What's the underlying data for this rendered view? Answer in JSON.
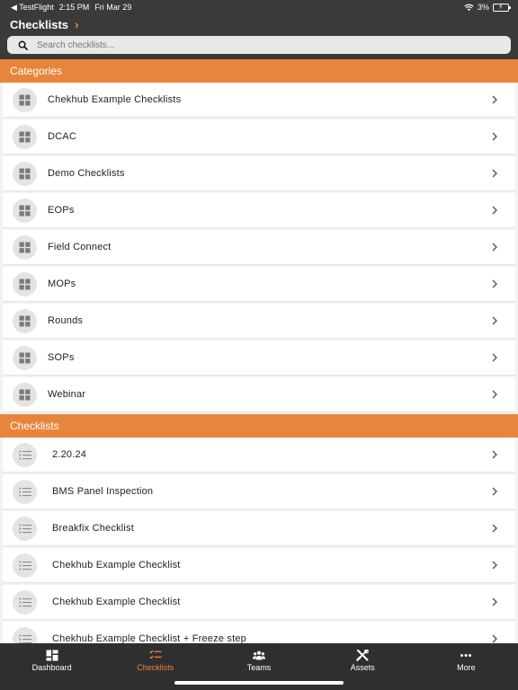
{
  "status": {
    "back_app": "◀ TestFlight",
    "time": "2:15 PM",
    "date": "Fri Mar 29",
    "battery": "3%"
  },
  "nav": {
    "title": "Checklists",
    "chevron": "›"
  },
  "search": {
    "placeholder": "Search checklists..."
  },
  "sections": {
    "categories_title": "Categories",
    "checklists_title": "Checklists"
  },
  "categories": [
    {
      "label": "Chekhub Example Checklists",
      "icon": "grid-icon"
    },
    {
      "label": "DCAC",
      "icon": "grid-icon"
    },
    {
      "label": "Demo Checklists",
      "icon": "grid-icon"
    },
    {
      "label": "EOPs",
      "icon": "grid-icon"
    },
    {
      "label": "Field Connect",
      "icon": "grid-icon"
    },
    {
      "label": "MOPs",
      "icon": "grid-icon"
    },
    {
      "label": "Rounds",
      "icon": "grid-icon"
    },
    {
      "label": "SOPs",
      "icon": "grid-icon"
    },
    {
      "label": "Webinar",
      "icon": "grid-icon"
    }
  ],
  "checklists": [
    {
      "label": "2.20.24",
      "icon": "list-icon"
    },
    {
      "label": "BMS Panel Inspection",
      "icon": "list-icon"
    },
    {
      "label": "Breakfix Checklist",
      "icon": "list-icon"
    },
    {
      "label": "Chekhub Example Checklist",
      "icon": "list-icon"
    },
    {
      "label": "Chekhub Example Checklist",
      "icon": "list-icon"
    },
    {
      "label": "Chekhub Example Checklist + Freeze step",
      "icon": "list-icon"
    }
  ],
  "tabs": [
    {
      "label": "Dashboard",
      "icon": "dashboard-icon",
      "active": false
    },
    {
      "label": "Checklists",
      "icon": "checklists-icon",
      "active": true
    },
    {
      "label": "Teams",
      "icon": "teams-icon",
      "active": false
    },
    {
      "label": "Assets",
      "icon": "assets-icon",
      "active": false
    },
    {
      "label": "More",
      "icon": "more-icon",
      "active": false
    }
  ],
  "colors": {
    "accent": "#e8853d",
    "topbar": "#3a3a3a",
    "tabbar": "#2f2f2f"
  }
}
